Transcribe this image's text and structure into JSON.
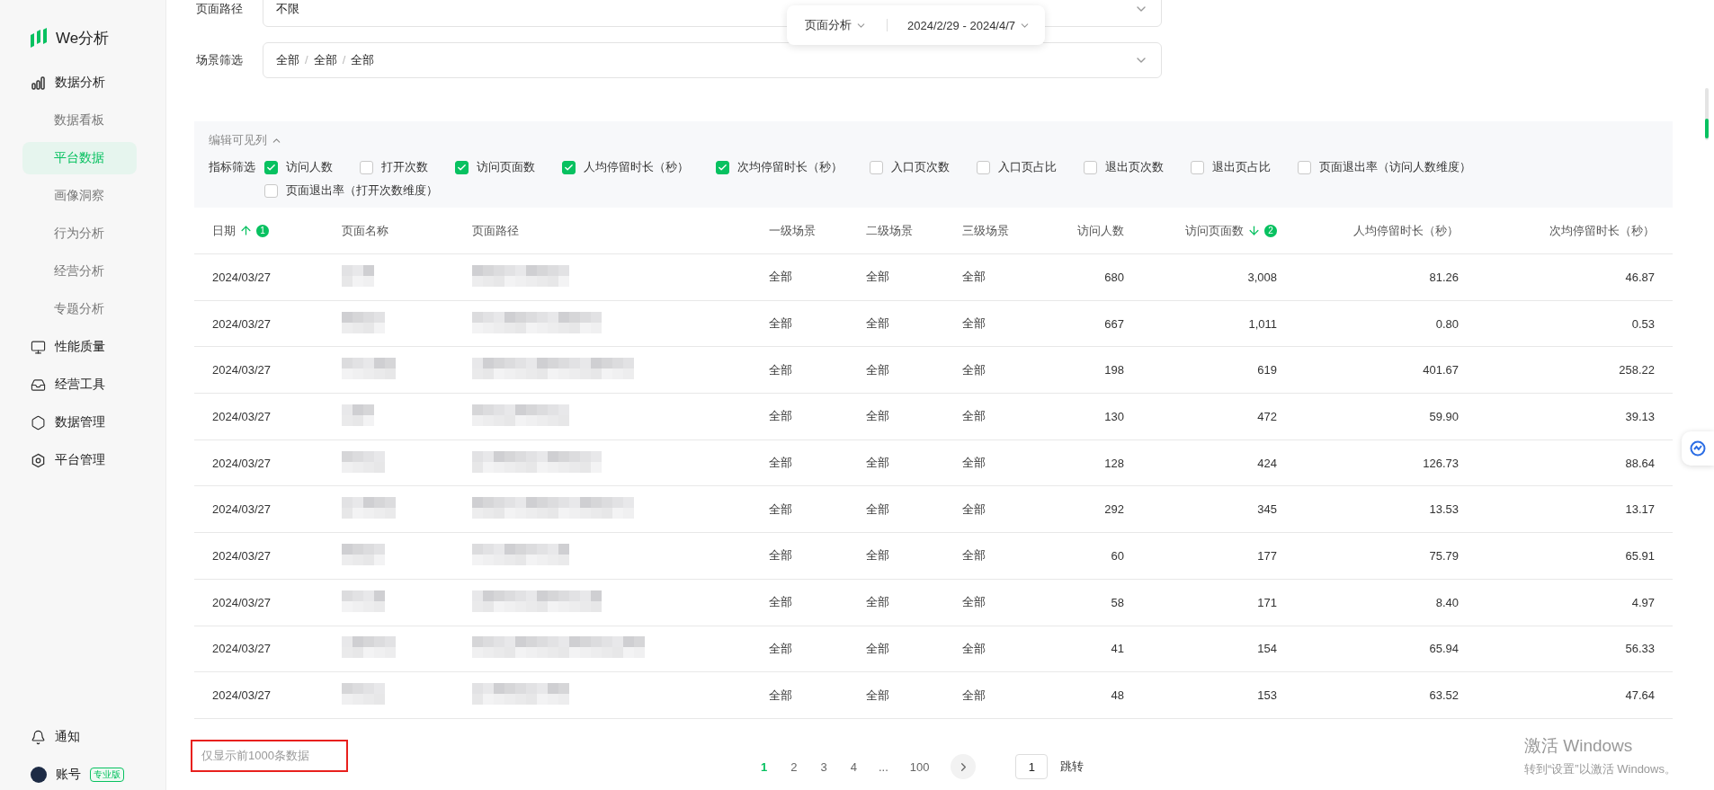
{
  "sidebar": {
    "logo": "We分析",
    "items": [
      {
        "label": "数据分析",
        "children": [
          {
            "label": "数据看板",
            "selected": false
          },
          {
            "label": "平台数据",
            "selected": true
          },
          {
            "label": "画像洞察",
            "selected": false
          },
          {
            "label": "行为分析",
            "selected": false
          },
          {
            "label": "经营分析",
            "selected": false
          },
          {
            "label": "专题分析",
            "selected": false
          }
        ]
      },
      {
        "label": "性能质量"
      },
      {
        "label": "经营工具"
      },
      {
        "label": "数据管理"
      },
      {
        "label": "平台管理"
      }
    ],
    "notifications": "通知",
    "account": {
      "label": "账号",
      "badge": "专业版"
    }
  },
  "floating_toolbar": {
    "analysis": "页面分析",
    "date_start": "2024/2/29",
    "separator": "-",
    "date_end": "2024/4/7"
  },
  "filters": [
    {
      "label": "页面路径",
      "kind": "text",
      "value": "不限"
    },
    {
      "label": "场景筛选",
      "kind": "cascade",
      "values": [
        "全部",
        "全部",
        "全部"
      ],
      "separator": "/"
    }
  ],
  "column_config": {
    "toggle_label": "编辑可见列",
    "expanded": true,
    "filter_label": "指标筛选",
    "options": [
      {
        "label": "访问人数",
        "checked": true
      },
      {
        "label": "打开次数",
        "checked": false
      },
      {
        "label": "访问页面数",
        "checked": true
      },
      {
        "label": "人均停留时长（秒）",
        "checked": true
      },
      {
        "label": "次均停留时长（秒）",
        "checked": true
      },
      {
        "label": "入口页次数",
        "checked": false
      },
      {
        "label": "入口页占比",
        "checked": false
      },
      {
        "label": "退出页次数",
        "checked": false
      },
      {
        "label": "退出页占比",
        "checked": false
      },
      {
        "label": "页面退出率（访问人数维度）",
        "checked": false
      },
      {
        "label": "页面退出率（打开次数维度）",
        "checked": false
      }
    ]
  },
  "table": {
    "columns": [
      {
        "label": "日期",
        "kind": "text",
        "sorted": true,
        "ascending": true,
        "sort_order": "1"
      },
      {
        "label": "页面名称",
        "kind": "redacted",
        "sorted": false
      },
      {
        "label": "页面路径",
        "kind": "redacted",
        "sorted": false
      },
      {
        "label": "一级场景",
        "kind": "text",
        "sorted": false
      },
      {
        "label": "二级场景",
        "kind": "text",
        "sorted": false
      },
      {
        "label": "三级场景",
        "kind": "text",
        "sorted": false
      },
      {
        "label": "访问人数",
        "kind": "number",
        "sorted": false
      },
      {
        "label": "访问页面数",
        "kind": "number",
        "sorted": true,
        "ascending": false,
        "sort_order": "2"
      },
      {
        "label": "人均停留时长（秒）",
        "kind": "number",
        "sorted": false
      },
      {
        "label": "次均停留时长（秒）",
        "kind": "number",
        "sorted": false
      }
    ],
    "rows": [
      {
        "values": [
          "2024/03/27",
          "全部",
          "全部",
          "全部",
          "680",
          "3,008",
          "81.26",
          "46.87"
        ]
      },
      {
        "values": [
          "2024/03/27",
          "全部",
          "全部",
          "全部",
          "667",
          "1,011",
          "0.80",
          "0.53"
        ]
      },
      {
        "values": [
          "2024/03/27",
          "全部",
          "全部",
          "全部",
          "198",
          "619",
          "401.67",
          "258.22"
        ]
      },
      {
        "values": [
          "2024/03/27",
          "全部",
          "全部",
          "全部",
          "130",
          "472",
          "59.90",
          "39.13"
        ]
      },
      {
        "values": [
          "2024/03/27",
          "全部",
          "全部",
          "全部",
          "128",
          "424",
          "126.73",
          "88.64"
        ]
      },
      {
        "values": [
          "2024/03/27",
          "全部",
          "全部",
          "全部",
          "292",
          "345",
          "13.53",
          "13.17"
        ]
      },
      {
        "values": [
          "2024/03/27",
          "全部",
          "全部",
          "全部",
          "60",
          "177",
          "75.79",
          "65.91"
        ]
      },
      {
        "values": [
          "2024/03/27",
          "全部",
          "全部",
          "全部",
          "58",
          "171",
          "8.40",
          "4.97"
        ]
      },
      {
        "values": [
          "2024/03/27",
          "全部",
          "全部",
          "全部",
          "41",
          "154",
          "65.94",
          "56.33"
        ]
      },
      {
        "values": [
          "2024/03/27",
          "全部",
          "全部",
          "全部",
          "48",
          "153",
          "63.52",
          "47.64"
        ]
      }
    ]
  },
  "footer": {
    "note": "仅显示前1000条数据",
    "note_highlighted": true,
    "pages": [
      {
        "label": "1",
        "kind": "page",
        "selected": true
      },
      {
        "label": "2",
        "kind": "page",
        "selected": false
      },
      {
        "label": "3",
        "kind": "page",
        "selected": false
      },
      {
        "label": "4",
        "kind": "page",
        "selected": false
      },
      {
        "label": "...",
        "kind": "ellipsis"
      },
      {
        "label": "100",
        "kind": "page",
        "selected": false
      }
    ],
    "jump_value": "1",
    "jump_label": "跳转"
  },
  "activation_notice": {
    "title": "激活 Windows",
    "subtitle": "转到“设置”以激活 Windows。"
  }
}
